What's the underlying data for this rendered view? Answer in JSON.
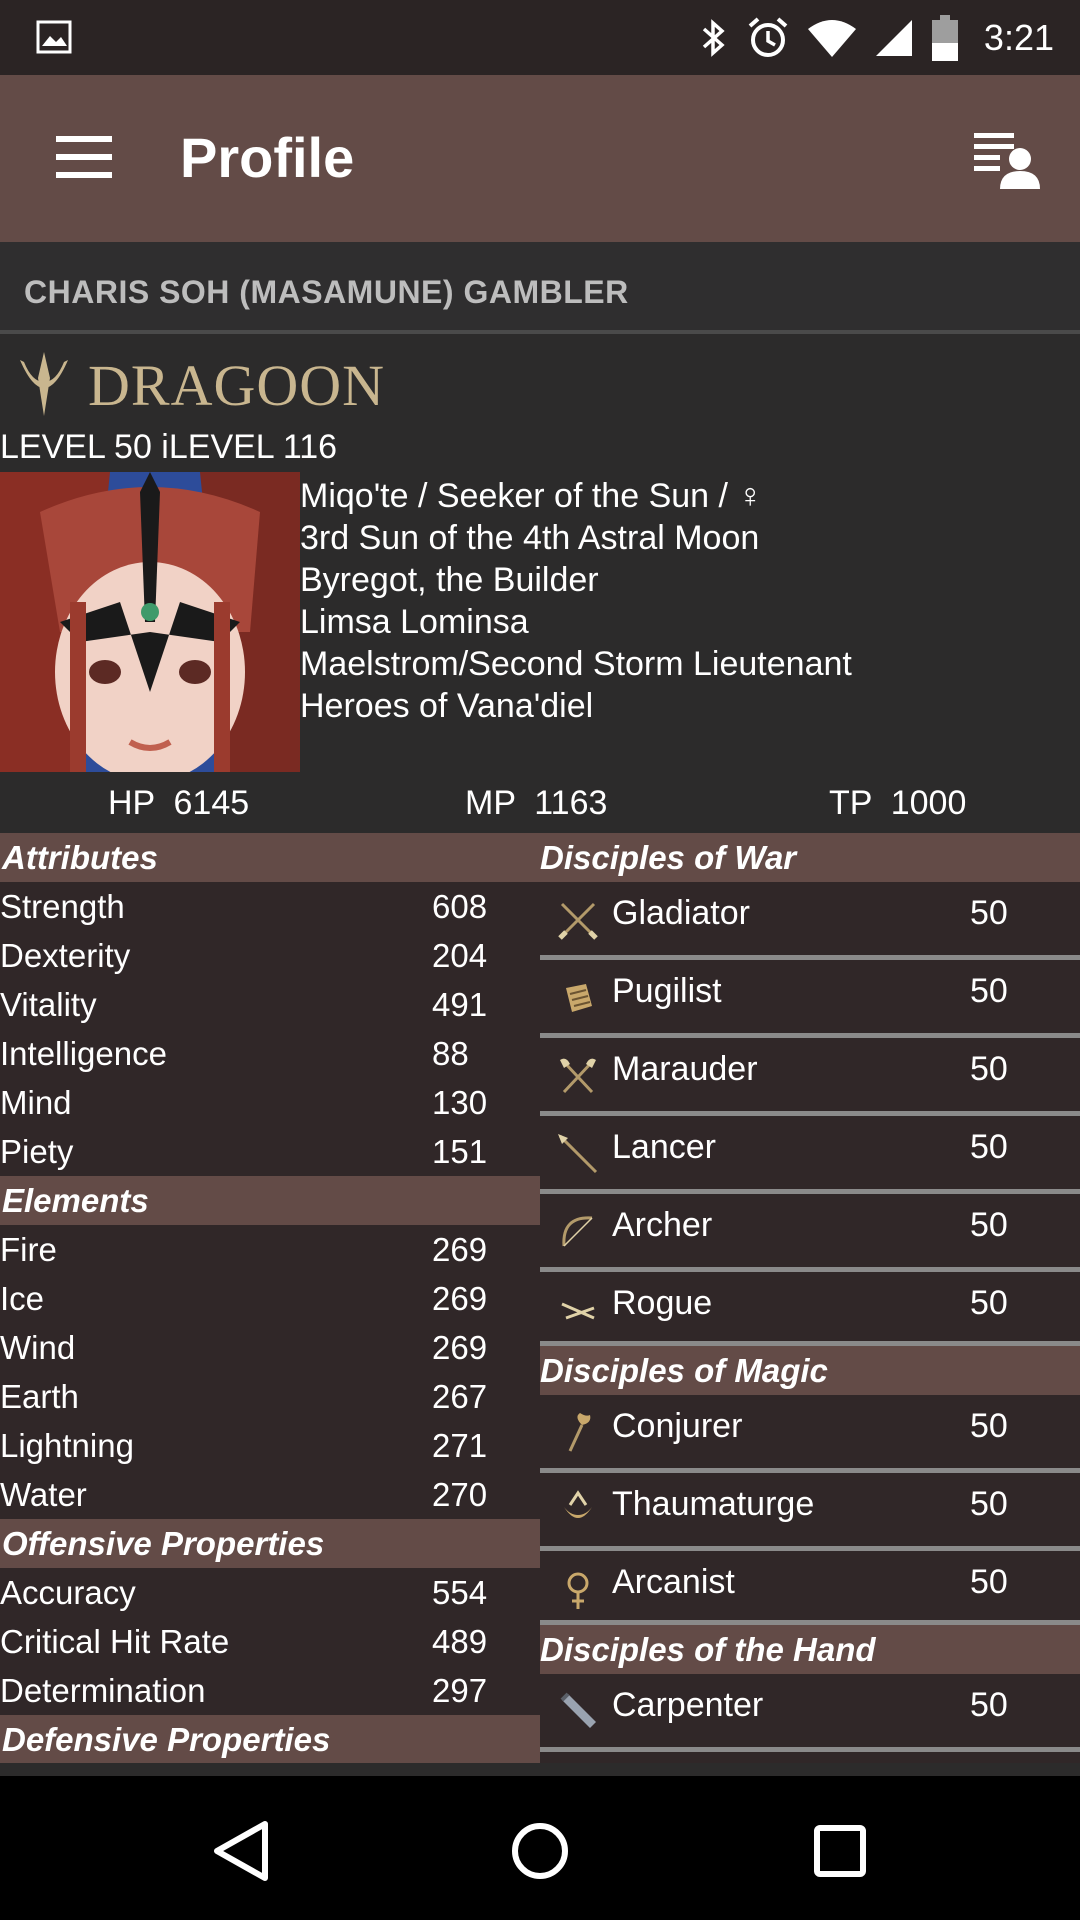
{
  "status_bar": {
    "time": "3:21",
    "icons": [
      "image-icon",
      "bluetooth-icon",
      "alarm-icon",
      "wifi-icon",
      "signal-icon",
      "battery-icon"
    ]
  },
  "app_bar": {
    "title": "Profile",
    "menu_icon": "hamburger-menu-icon",
    "action_icon": "character-list-icon"
  },
  "character": {
    "name": "CHARIS SOH (MASAMUNE) GAMBLER",
    "job": "DRAGOON",
    "level_line": "LEVEL 50 iLEVEL 116",
    "info": [
      "Miqo'te / Seeker of the Sun / ♀",
      "3rd Sun of the 4th Astral Moon",
      "Byregot, the Builder",
      "Limsa Lominsa",
      "Maelstrom/Second Storm Lieutenant",
      "Heroes of Vana'diel"
    ],
    "hp": "HP  6145",
    "mp": "MP  1163",
    "tp": "TP  1000"
  },
  "attributes": {
    "title": "Attributes",
    "rows": [
      {
        "label": "Strength",
        "value": "608"
      },
      {
        "label": "Dexterity",
        "value": "204"
      },
      {
        "label": "Vitality",
        "value": "491"
      },
      {
        "label": "Intelligence",
        "value": "88"
      },
      {
        "label": "Mind",
        "value": "130"
      },
      {
        "label": "Piety",
        "value": "151"
      }
    ]
  },
  "elements": {
    "title": "Elements",
    "rows": [
      {
        "label": "Fire",
        "value": "269"
      },
      {
        "label": "Ice",
        "value": "269"
      },
      {
        "label": "Wind",
        "value": "269"
      },
      {
        "label": "Earth",
        "value": "267"
      },
      {
        "label": "Lightning",
        "value": "271"
      },
      {
        "label": "Water",
        "value": "270"
      }
    ]
  },
  "offensive": {
    "title": "Offensive Properties",
    "rows": [
      {
        "label": "Accuracy",
        "value": "554"
      },
      {
        "label": "Critical Hit Rate",
        "value": "489"
      },
      {
        "label": "Determination",
        "value": "297"
      }
    ]
  },
  "defensive": {
    "title": "Defensive Properties"
  },
  "disciples_war": {
    "title": "Disciples of War",
    "classes": [
      {
        "name": "Gladiator",
        "level": "50",
        "icon": "crossed-swords-icon"
      },
      {
        "name": "Pugilist",
        "level": "50",
        "icon": "fist-weapon-icon"
      },
      {
        "name": "Marauder",
        "level": "50",
        "icon": "crossed-axes-icon"
      },
      {
        "name": "Lancer",
        "level": "50",
        "icon": "lance-icon"
      },
      {
        "name": "Archer",
        "level": "50",
        "icon": "bow-icon"
      },
      {
        "name": "Rogue",
        "level": "50",
        "icon": "daggers-icon"
      }
    ]
  },
  "disciples_magic": {
    "title": "Disciples of Magic",
    "classes": [
      {
        "name": "Conjurer",
        "level": "50",
        "icon": "staff-icon"
      },
      {
        "name": "Thaumaturge",
        "level": "50",
        "icon": "sceptre-icon"
      },
      {
        "name": "Arcanist",
        "level": "50",
        "icon": "grimoire-icon"
      }
    ]
  },
  "disciples_hand": {
    "title": "Disciples of the Hand",
    "classes": [
      {
        "name": "Carpenter",
        "level": "50",
        "icon": "saw-icon"
      }
    ]
  },
  "nav_bar": {
    "icons": [
      "back-icon",
      "home-icon",
      "recents-icon"
    ]
  },
  "colors": {
    "status_bar": "#2b2424",
    "app_bar": "#634b47",
    "section_header": "#634b47",
    "list_background": "#302728",
    "job_name": "#c9b68f"
  }
}
